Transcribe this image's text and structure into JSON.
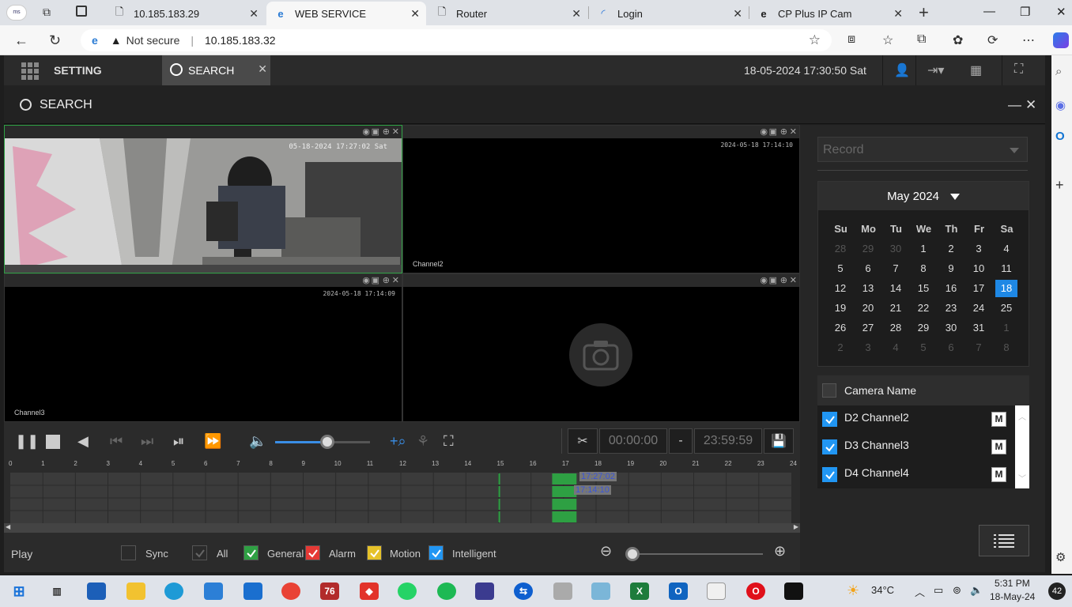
{
  "browser": {
    "tabs": [
      {
        "label": "10.185.183.29"
      },
      {
        "label": "WEB SERVICE"
      },
      {
        "label": "Router"
      },
      {
        "label": "Login"
      },
      {
        "label": "CP Plus IP Cam"
      }
    ],
    "address": {
      "security": "Not secure",
      "url": "10.185.183.32"
    }
  },
  "app": {
    "nav": {
      "setting": "SETTING",
      "search_tab": "SEARCH"
    },
    "datetime": "18-05-2024 17:30:50 Sat",
    "page_title": "SEARCH",
    "panes": [
      {
        "timestamp": "05-18-2024 17:27:02 Sat",
        "channel": "",
        "has_image": true
      },
      {
        "timestamp": "2024-05-18 17:14:10",
        "channel": "Channel2"
      },
      {
        "timestamp": "2024-05-18 17:14:09",
        "channel": "Channel3"
      },
      {
        "timestamp": "",
        "channel": ""
      }
    ],
    "volume_level": 0.55,
    "clip": {
      "start": "00:00:00",
      "dash": "-",
      "end": "23:59:59"
    },
    "timeline": {
      "hours": [
        "0",
        "1",
        "2",
        "3",
        "4",
        "5",
        "6",
        "7",
        "8",
        "9",
        "10",
        "11",
        "12",
        "13",
        "14",
        "15",
        "16",
        "17",
        "18",
        "19",
        "20",
        "21",
        "22",
        "23",
        "24"
      ],
      "marker1": "17:27:02",
      "marker2": "17:14:10"
    },
    "bottom": {
      "play": "Play",
      "sync": "Sync",
      "all": "All",
      "general": "General",
      "alarm": "Alarm",
      "motion": "Motion",
      "intelligent": "Intelligent",
      "colors": {
        "general": "#2ea043",
        "alarm": "#e53935",
        "motion": "#e6c229",
        "intelligent": "#2196f3"
      }
    },
    "right": {
      "record_placeholder": "Record",
      "calendar": {
        "month": "May 2024",
        "dow": [
          "Su",
          "Mo",
          "Tu",
          "We",
          "Th",
          "Fr",
          "Sa"
        ],
        "weeks": [
          [
            "28",
            "29",
            "30",
            "1",
            "2",
            "3",
            "4"
          ],
          [
            "5",
            "6",
            "7",
            "8",
            "9",
            "10",
            "11"
          ],
          [
            "12",
            "13",
            "14",
            "15",
            "16",
            "17",
            "18"
          ],
          [
            "19",
            "20",
            "21",
            "22",
            "23",
            "24",
            "25"
          ],
          [
            "26",
            "27",
            "28",
            "29",
            "30",
            "31",
            "1"
          ],
          [
            "2",
            "3",
            "4",
            "5",
            "6",
            "7",
            "8"
          ]
        ],
        "selected": "18"
      },
      "camera_header": "Camera Name",
      "cameras": [
        {
          "label": "D2 Channel2",
          "m": "M"
        },
        {
          "label": "D3 Channel3",
          "m": "M"
        },
        {
          "label": "D4 Channel4",
          "m": "M"
        }
      ]
    }
  },
  "taskbar": {
    "weather": "34°C",
    "time": "5:31 PM",
    "date": "18-May-24",
    "badge": "42"
  }
}
